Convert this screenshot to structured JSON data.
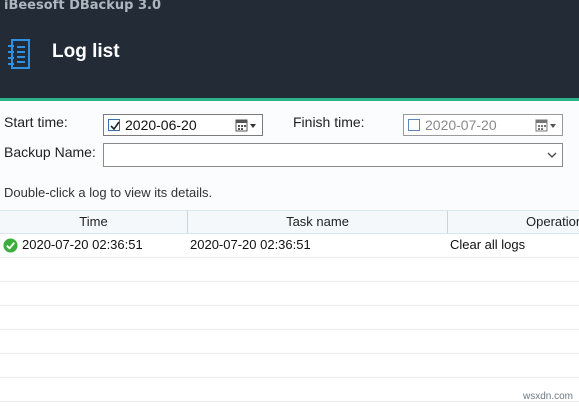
{
  "app": {
    "title": "iBeesoft DBackup 3.0"
  },
  "header": {
    "title": "Log list",
    "icon": "log-list-icon"
  },
  "filter": {
    "start_label": "Start time:",
    "start_checked": true,
    "start_date": "2020-06-20",
    "finish_label": "Finish time:",
    "finish_checked": false,
    "finish_date": "2020-07-20",
    "backup_name_label": "Backup Name:",
    "backup_name_value": ""
  },
  "hint": "Double-click a log to view its details.",
  "table": {
    "columns": [
      "Time",
      "Task name",
      "Operation"
    ],
    "rows": [
      {
        "status_icon": "success-check-icon",
        "time": "2020-07-20 02:36:51",
        "task_name": "2020-07-20 02:36:51",
        "operation": "Clear all logs"
      }
    ]
  },
  "watermark": "wsxdn.com",
  "colors": {
    "header_bg": "#222b36",
    "accent": "#2bb38a",
    "success": "#3cae3c",
    "icon_blue": "#2f8fe0"
  }
}
